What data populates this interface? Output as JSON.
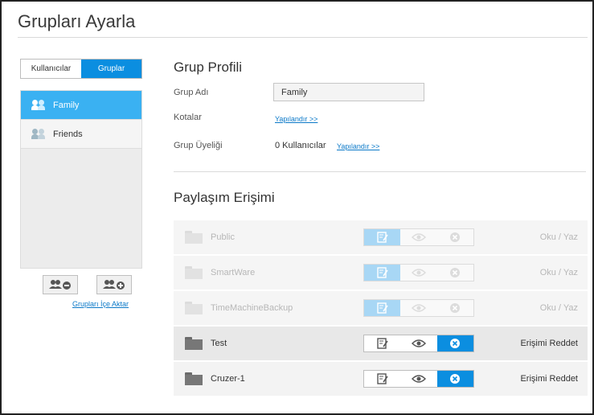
{
  "page": {
    "title": "Grupları Ayarla"
  },
  "tabs": {
    "users": "Kullanıcılar",
    "groups": "Gruplar"
  },
  "groups": [
    {
      "name": "Family",
      "selected": true
    },
    {
      "name": "Friends",
      "selected": false
    }
  ],
  "group_actions": {
    "import_link": "Grupları İçe Aktar"
  },
  "profile": {
    "heading": "Grup Profili",
    "name_label": "Grup Adı",
    "name_value": "Family",
    "quota_label": "Kotalar",
    "quota_link": "Yapılandır >>",
    "membership_label": "Grup Üyeliği",
    "membership_value": "0 Kullanıcılar",
    "membership_link": "Yapılandır >>"
  },
  "share_access": {
    "heading": "Paylaşım Erişimi",
    "shares": [
      {
        "name": "Public",
        "status": "Oku / Yaz",
        "enabled": false,
        "selected_permission": "read-write"
      },
      {
        "name": "SmartWare",
        "status": "Oku / Yaz",
        "enabled": false,
        "selected_permission": "read-write"
      },
      {
        "name": "TimeMachineBackup",
        "status": "Oku / Yaz",
        "enabled": false,
        "selected_permission": "read-write"
      },
      {
        "name": "Test",
        "status": "Erişimi Reddet",
        "enabled": true,
        "selected_permission": "deny"
      },
      {
        "name": "Cruzer-1",
        "status": "Erişimi Reddet",
        "enabled": true,
        "selected_permission": "deny"
      }
    ]
  },
  "colors": {
    "accent": "#0b8ee0",
    "selected_row": "#3ab1f2",
    "link": "#0b79c8"
  }
}
